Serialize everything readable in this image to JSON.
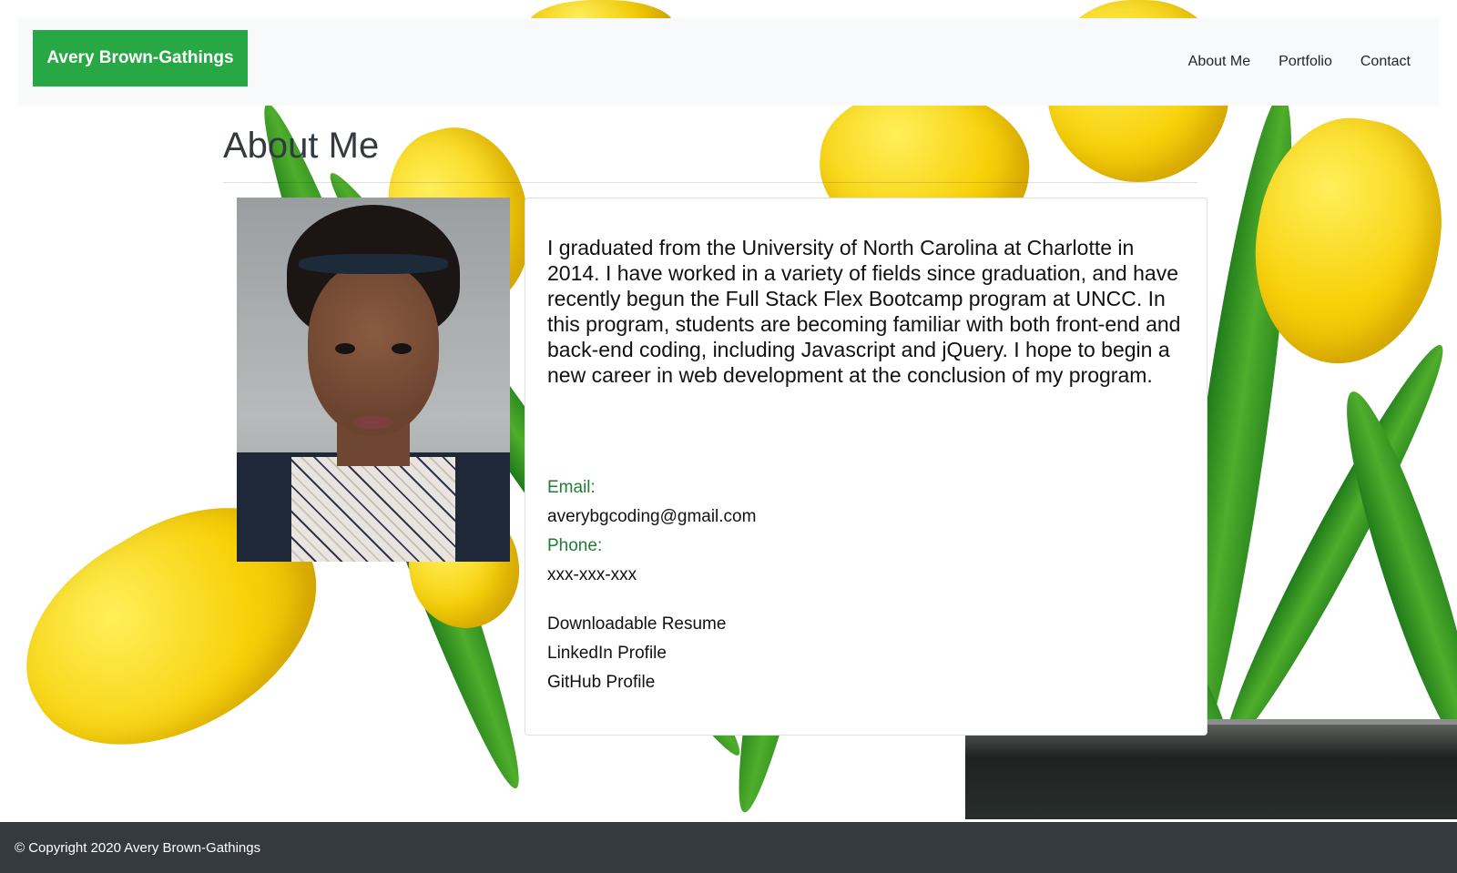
{
  "navbar": {
    "brand": "Avery Brown-Gathings",
    "links": [
      "About Me",
      "Portfolio",
      "Contact"
    ]
  },
  "main": {
    "title": "About Me",
    "photo_alt": "Portrait of Avery Brown-Gathings",
    "bio": "I graduated from the University of North Carolina at Charlotte in 2014. I have worked in a variety of fields since graduation, and have recently begun the Full Stack Flex Bootcamp program at UNCC. In this program, students are becoming familiar with both front-end and back-end coding, including Javascript and jQuery. I hope to begin a new career in web development at the conclusion of my program.",
    "contact": {
      "email_label": "Email:",
      "email_value": "averybgcoding@gmail.com",
      "phone_label": "Phone:",
      "phone_value": "xxx-xxx-xxx"
    },
    "links": [
      "Downloadable Resume",
      "LinkedIn Profile",
      "GitHub Profile"
    ]
  },
  "footer": {
    "copyright": "© Copyright 2020 Avery Brown-Gathings"
  },
  "colors": {
    "brand_green": "#28a745",
    "label_green": "#1e7e34",
    "navbar_bg": "#f8f9fa",
    "footer_bg": "#343a40",
    "tulip_yellow": "#f7d10a"
  }
}
